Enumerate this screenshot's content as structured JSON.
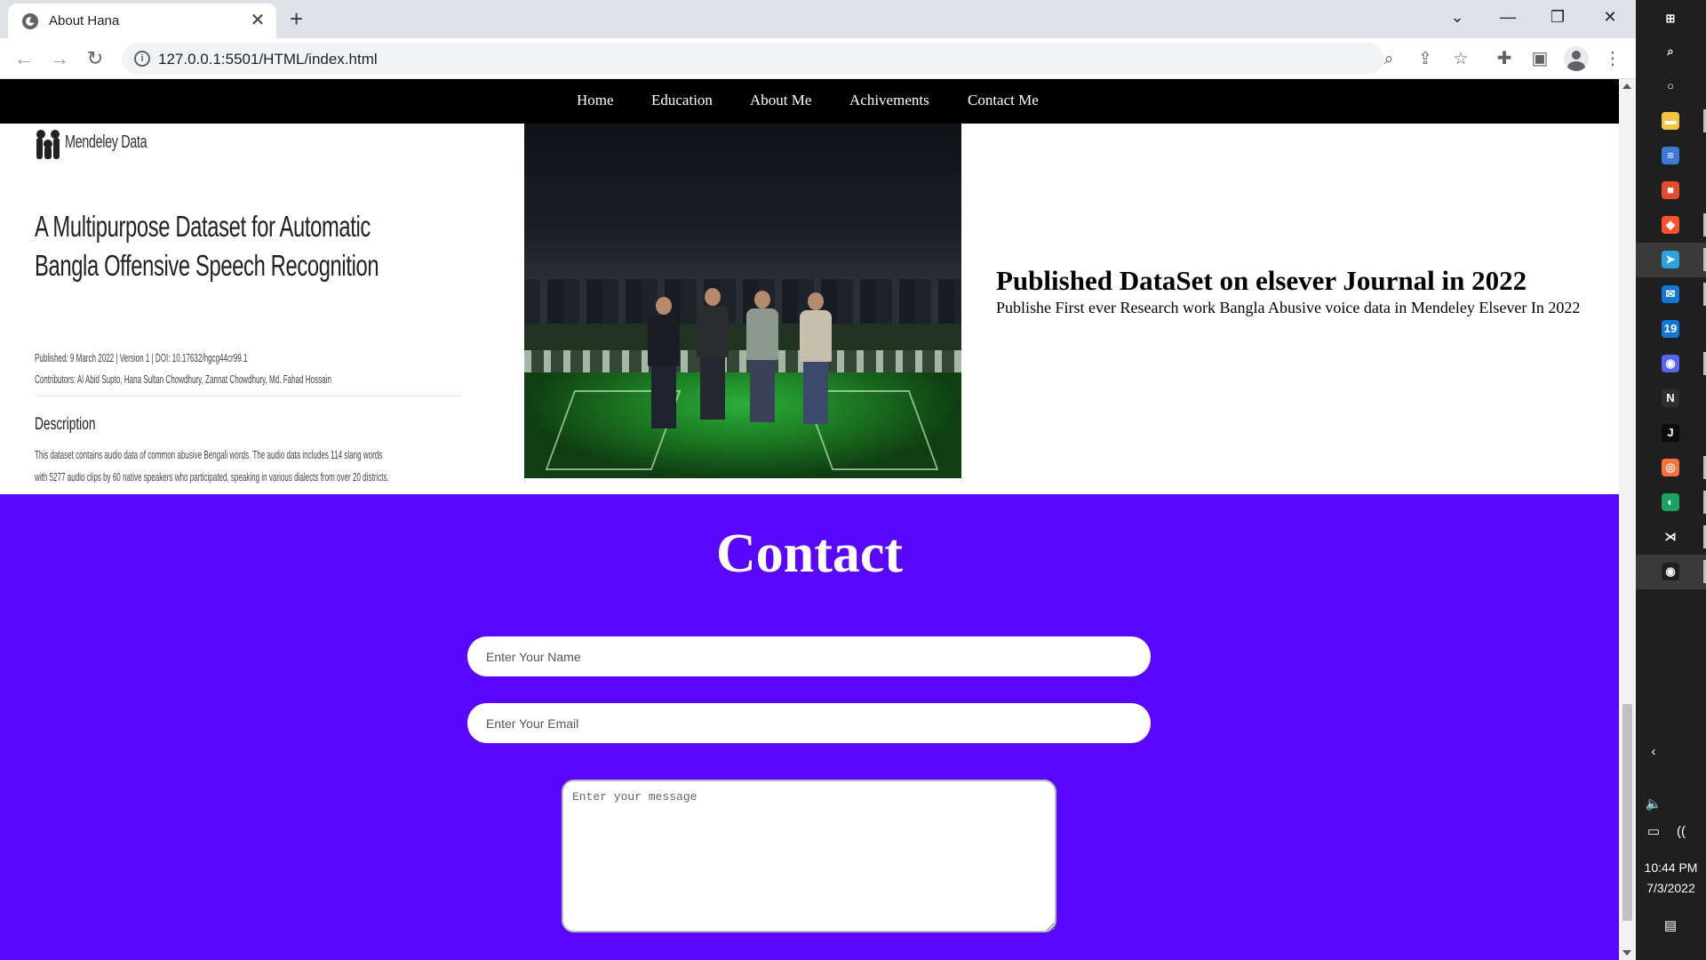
{
  "browser": {
    "tab_title": "About Hana",
    "tab_close": "✕",
    "new_tab": "+",
    "url": "127.0.0.1:5501/HTML/index.html",
    "window_controls": {
      "tab_search": "⌄",
      "minimize": "—",
      "restore": "❐",
      "close": "✕"
    },
    "nav_icons": {
      "back": "←",
      "forward": "→",
      "reload": "↻"
    },
    "omnibox_icons": {
      "info": "i",
      "zoom": "⌕",
      "share": "⇪",
      "bookmark": "☆"
    },
    "toolbar_icons": {
      "extensions": "✚",
      "side_panel": "▣",
      "menu": "⋮"
    }
  },
  "site": {
    "nav": [
      "Home",
      "Education",
      "About Me",
      "Achivements",
      "Contact Me"
    ],
    "dataset_card": {
      "brand": "Mendeley Data",
      "title": "A Multipurpose Dataset for Automatic Bangla Offensive Speech Recognition",
      "meta": "Published: 9 March 2022 | Version 1 | DOI: 10.17632/hgcg44cr99.1",
      "contributors": "Contributors: Al Abid Supto, Hana Sultan Chowdhury, Zannat Chowdhury, Md. Fahad Hossain",
      "description_heading": "Description",
      "description": "This dataset contains audio data of common abusive Bengali words. The audio data includes 114 slang words with 5277 audio clips by 60 native speakers who participated, speaking in various dialects from over 20 districts. The recorded audio data is natively recorded by the participants in .WAV format."
    },
    "publication": {
      "heading": "Published DataSet on elsever Journal in 2022",
      "text": "Publishe First ever Research work Bangla Abusive voice data in Mendeley Elsever In 2022"
    },
    "contact": {
      "title": "Contact",
      "name_placeholder": "Enter Your Name",
      "email_placeholder": "Enter Your Email",
      "message_placeholder": "Enter your message",
      "background": "#5907ff"
    }
  },
  "taskbar": {
    "apps": [
      {
        "name": "windows-start-icon",
        "glyph": "⊞",
        "color": "#1f1f1f"
      },
      {
        "name": "search-icon",
        "glyph": "⌕",
        "color": "#1f1f1f"
      },
      {
        "name": "cortana-icon",
        "glyph": "○",
        "color": "#1f1f1f"
      },
      {
        "name": "file-explorer-icon",
        "glyph": "▬",
        "color": "#f5c142"
      },
      {
        "name": "app-icon",
        "glyph": "≡",
        "color": "#3c7bd6"
      },
      {
        "name": "store-icon",
        "glyph": "■",
        "color": "#e44b2a"
      },
      {
        "name": "brave-icon",
        "glyph": "◆",
        "color": "#fb542b"
      },
      {
        "name": "telegram-icon",
        "glyph": "➤",
        "color": "#2aa3df"
      },
      {
        "name": "mail-icon",
        "glyph": "✉",
        "color": "#0f78d4"
      },
      {
        "name": "calendar-icon",
        "glyph": "19",
        "color": "#0f78d4"
      },
      {
        "name": "discord-icon",
        "glyph": "◉",
        "color": "#5865f2"
      },
      {
        "name": "notion-icon",
        "glyph": "N",
        "color": "#2f2f2f"
      },
      {
        "name": "jetbrains-icon",
        "glyph": "J",
        "color": "#0b0b0b"
      },
      {
        "name": "firefox-icon",
        "glyph": "◎",
        "color": "#ff7139"
      },
      {
        "name": "edge-icon",
        "glyph": "◐",
        "color": "#1aa163"
      },
      {
        "name": "vscode-icon",
        "glyph": "⋊",
        "color": "#1f1f1f"
      },
      {
        "name": "chrome-icon",
        "glyph": "◉",
        "color": "#1f1f1f"
      }
    ],
    "tray": {
      "chevron": "‹",
      "volume": "🔈",
      "battery": "▭",
      "wifi": "(("
    },
    "time": "10:44 PM",
    "date": "7/3/2022",
    "notifications": "▤"
  }
}
